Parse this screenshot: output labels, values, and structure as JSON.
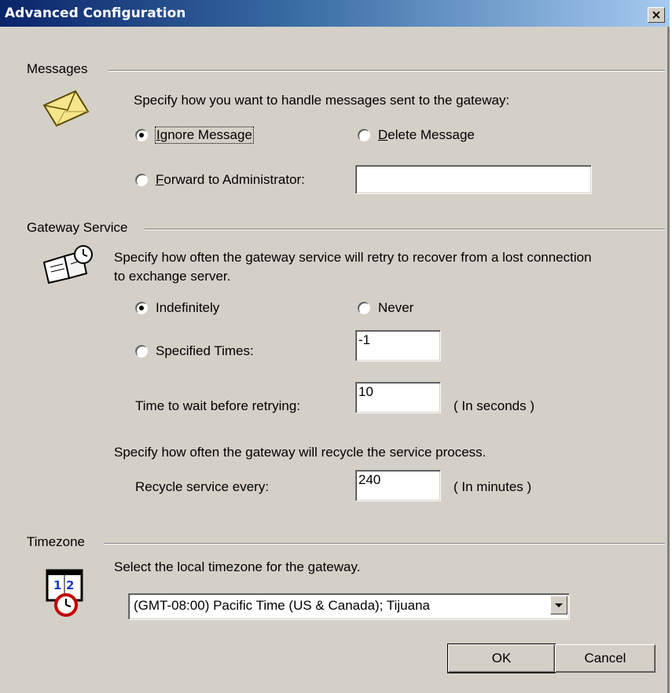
{
  "window": {
    "title": "Advanced Configuration",
    "close_label": "×"
  },
  "messages": {
    "group_label": "Messages",
    "instruction": "Specify how you want to handle messages sent to the gateway:",
    "ignore": {
      "mnemonic": "I",
      "rest": "gnore Message",
      "selected": true
    },
    "delete": {
      "mnemonic": "D",
      "rest": "elete Message",
      "selected": false
    },
    "forward": {
      "mnemonic": "F",
      "rest": "orward to Administrator:",
      "selected": false
    },
    "admin_value": ""
  },
  "gateway": {
    "group_label": "Gateway Service",
    "instruction_line1": "Specify how often the gateway service will retry to recover from a lost connection",
    "instruction_line2": "to exchange server.",
    "indefinitely": {
      "label": "Indefinitely",
      "selected": true
    },
    "never": {
      "label": "Never",
      "selected": false
    },
    "specified": {
      "label": "Specified Times:",
      "selected": false
    },
    "specified_value": "-1",
    "wait_label": "Time to wait before retrying:",
    "wait_value": "10",
    "wait_unit": "( In seconds )",
    "recycle_instruction": "Specify how often the gateway will recycle the service process.",
    "recycle_label": "Recycle service every:",
    "recycle_value": "240",
    "recycle_unit": "( In minutes )"
  },
  "timezone": {
    "group_label": "Timezone",
    "instruction": "Select the local timezone for the gateway.",
    "selected": "(GMT-08:00) Pacific Time (US & Canada); Tijuana"
  },
  "buttons": {
    "ok": "OK",
    "cancel": "Cancel"
  },
  "icons": {
    "messages": "envelope-icon",
    "gateway": "book-clock-icon",
    "timezone": "calendar-clock-icon"
  }
}
